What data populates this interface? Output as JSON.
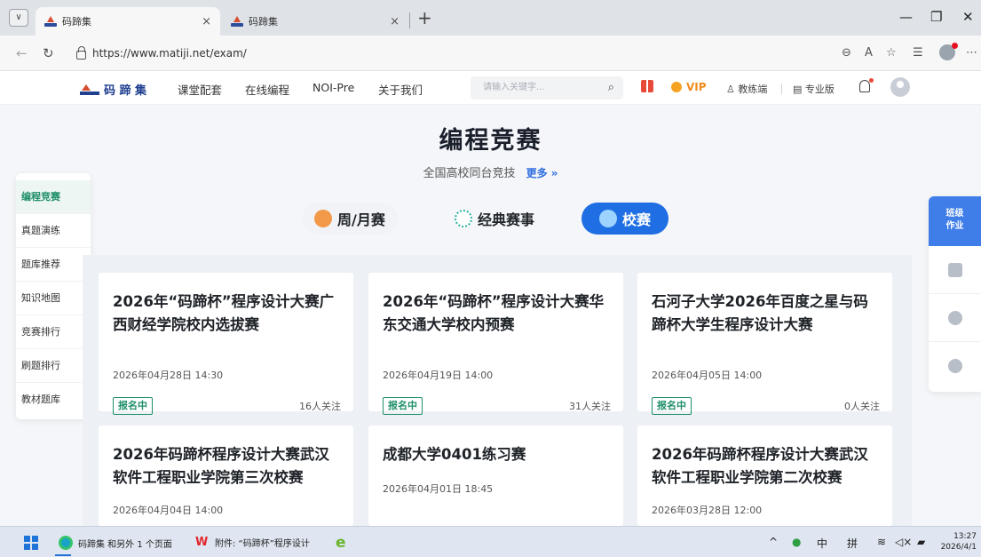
{
  "browser": {
    "tabs": [
      {
        "title": "码蹄集",
        "active": true
      },
      {
        "title": "码蹄集",
        "active": false
      }
    ],
    "close_glyph": "×",
    "new_tab_glyph": "+",
    "url": "https://www.matiji.net/exam/",
    "window_controls": {
      "minimize": "—",
      "restore": "❐",
      "close": "✕"
    }
  },
  "site": {
    "logo": "码 蹄 集",
    "nav": [
      "课堂配套",
      "在线编程",
      "NOI-Pre",
      "关于我们"
    ],
    "search_placeholder": "请输入关键字...",
    "vip": "VIP",
    "teacher": "教练端",
    "pro": "专业版"
  },
  "hero": {
    "title": "编程竞赛",
    "subtitle": "全国高校同台竞技",
    "more": "更多 »"
  },
  "categories": [
    "周/月赛",
    "经典赛事",
    "校赛"
  ],
  "sidebar": [
    "编程竞赛",
    "真题演练",
    "题库推荐",
    "知识地图",
    "竞赛排行",
    "刷题排行",
    "教材题库"
  ],
  "right_bar": {
    "homework_line1": "班级",
    "homework_line2": "作业"
  },
  "cards": [
    {
      "title": "2026年“码蹄杯”程序设计大赛广西财经学院校内选拔赛",
      "date": "2026年04月28日 14:30",
      "status": "报名中",
      "follow": "16人关注"
    },
    {
      "title": "2026年“码蹄杯”程序设计大赛华东交通大学校内预赛",
      "date": "2026年04月19日 14:00",
      "status": "报名中",
      "follow": "31人关注"
    },
    {
      "title": "石河子大学2026年百度之星与码蹄杯大学生程序设计大赛",
      "date": "2026年04月05日 14:00",
      "status": "报名中",
      "follow": "0人关注"
    },
    {
      "title": "2026年码蹄杯程序设计大赛武汉软件工程职业学院第三次校赛",
      "date": "2026年04月04日 14:00"
    },
    {
      "title": "成都大学0401练习赛",
      "date": "2026年04月01日 18:45"
    },
    {
      "title": "2026年码蹄杯程序设计大赛武汉软件工程职业学院第二次校赛",
      "date": "2026年03月28日 12:00"
    }
  ],
  "taskbar": {
    "browser_item": "码蹄集 和另外 1 个页面",
    "wps_item": "附件: “码蹄杯”程序设计",
    "ime_mode": "中",
    "ime_pinyin": "拼",
    "time": "13:27",
    "date": "2026/4/1"
  }
}
